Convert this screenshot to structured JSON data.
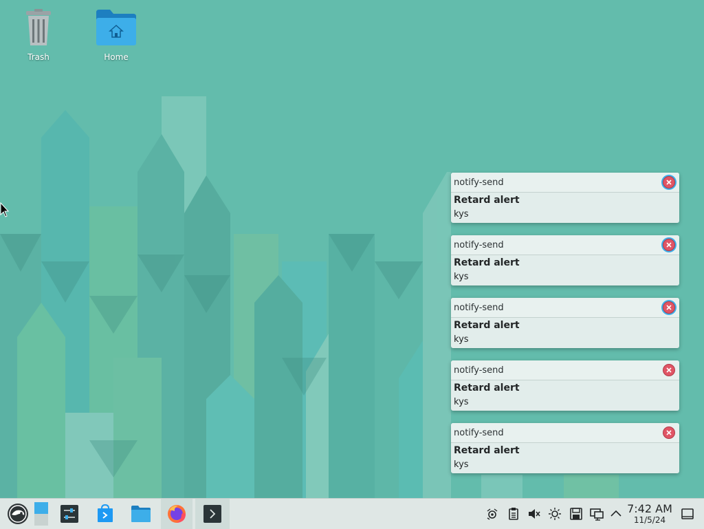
{
  "desktop": {
    "icons": [
      {
        "label": "Trash",
        "icon": "trash-icon"
      },
      {
        "label": "Home",
        "icon": "home-folder-icon"
      }
    ]
  },
  "notifications": [
    {
      "app": "notify-send",
      "title": "Retard alert",
      "body": "kys"
    },
    {
      "app": "notify-send",
      "title": "Retard alert",
      "body": "kys"
    },
    {
      "app": "notify-send",
      "title": "Retard alert",
      "body": "kys"
    },
    {
      "app": "notify-send",
      "title": "Retard alert",
      "body": "kys"
    },
    {
      "app": "notify-send",
      "title": "Retard alert",
      "body": "kys"
    }
  ],
  "taskbar": {
    "launchers": [
      {
        "icon": "application-launcher-icon"
      },
      {
        "icon": "pager-icon"
      },
      {
        "icon": "system-settings-icon"
      },
      {
        "icon": "discover-icon"
      },
      {
        "icon": "dolphin-file-manager-icon"
      },
      {
        "icon": "firefox-icon"
      },
      {
        "icon": "konsole-icon"
      }
    ],
    "tray": [
      {
        "icon": "kde-connect-icon"
      },
      {
        "icon": "clipboard-icon"
      },
      {
        "icon": "volume-muted-icon"
      },
      {
        "icon": "brightness-icon"
      },
      {
        "icon": "disk-icon"
      },
      {
        "icon": "network-icon"
      },
      {
        "icon": "expand-tray-icon"
      }
    ],
    "clock": {
      "time": "7:42 AM",
      "date": "11/5/24"
    },
    "show_desktop_icon": "show-desktop-icon"
  },
  "colors": {
    "wallpaper_base": "#63bcac",
    "close_button": "#e05565",
    "focus_ring": "#3daee9",
    "panel": "#dfe7e5"
  }
}
